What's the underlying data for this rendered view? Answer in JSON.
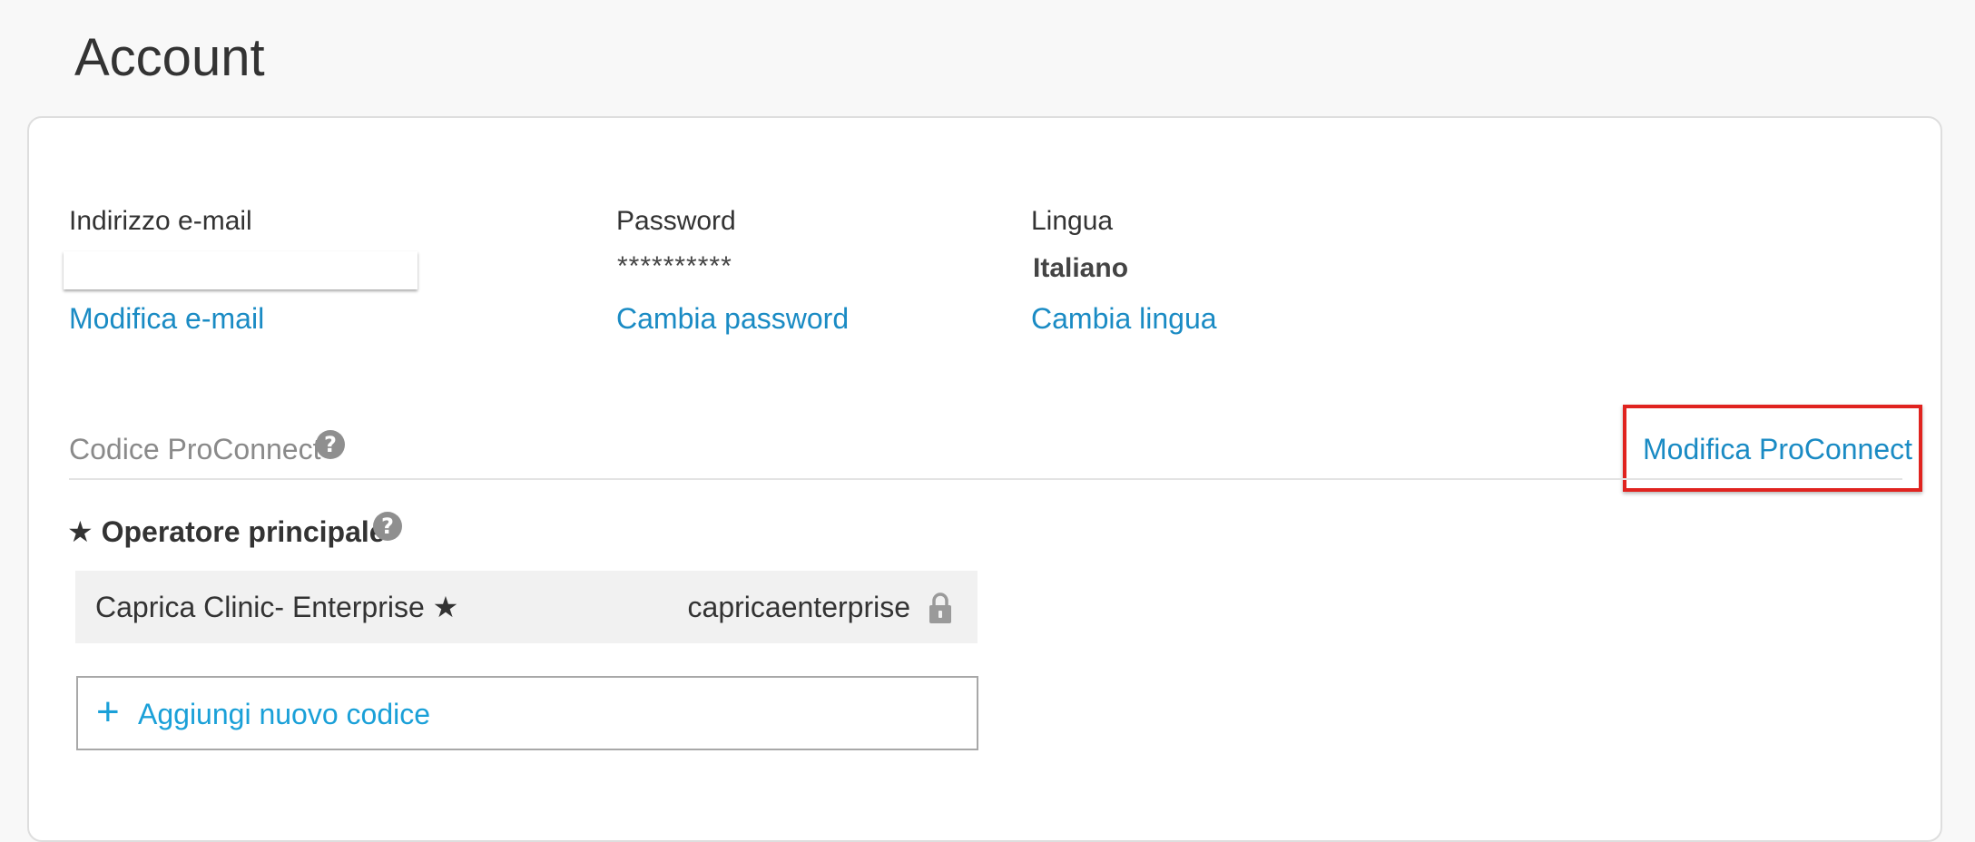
{
  "page": {
    "title": "Account"
  },
  "email": {
    "label": "Indirizzo e-mail",
    "value": "",
    "action": "Modifica e-mail"
  },
  "password": {
    "label": "Password",
    "value": "**********",
    "action": "Cambia password"
  },
  "language": {
    "label": "Lingua",
    "value": "Italiano",
    "action": "Cambia lingua"
  },
  "proconnect": {
    "section_label": "Codice ProConnect",
    "edit_action": "Modifica ProConnect",
    "help_icon": "question-circle-icon",
    "operator_heading": "★ Operatore principale",
    "codes": [
      {
        "name": "Caprica Clinic- Enterprise ★",
        "code": "capricaenterprise",
        "icon": "lock-icon"
      }
    ],
    "add_button": {
      "icon": "+",
      "label": "Aggiungi nuovo codice"
    }
  },
  "colors": {
    "link": "#1a8bc4",
    "add_accent": "#1aa0d8",
    "highlight": "#e0231f"
  }
}
